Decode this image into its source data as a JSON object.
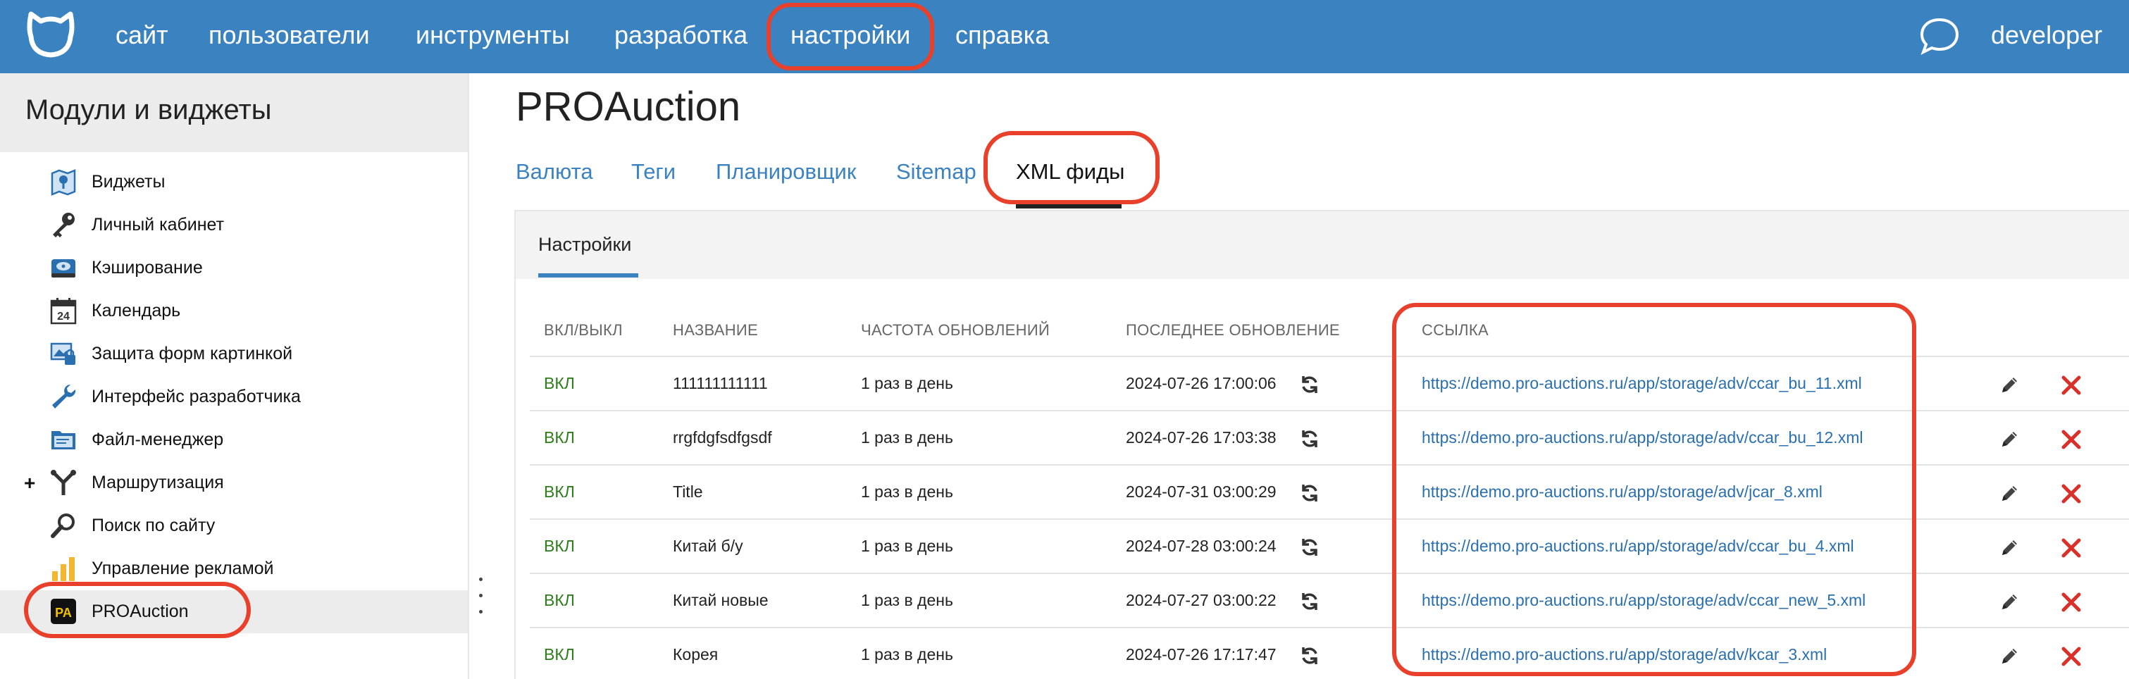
{
  "topbar": {
    "logo_icon": "cat-logo-icon",
    "nav": [
      {
        "label": "сайт"
      },
      {
        "label": "пользователи"
      },
      {
        "label": "инструменты"
      },
      {
        "label": "разработка"
      },
      {
        "label": "настройки"
      },
      {
        "label": "справка"
      }
    ],
    "chat_icon": "chat-bubble-icon",
    "user": "developer"
  },
  "sidebar": {
    "title": "Модули и виджеты",
    "items": [
      {
        "label": "Виджеты",
        "icon": "widgets-map-icon"
      },
      {
        "label": "Личный кабинет",
        "icon": "key-icon"
      },
      {
        "label": "Кэширование",
        "icon": "disk-cache-icon"
      },
      {
        "label": "Календарь",
        "icon": "calendar-icon",
        "icon_text": "24"
      },
      {
        "label": "Защита форм картинкой",
        "icon": "captcha-icon"
      },
      {
        "label": "Интерфейс разработчика",
        "icon": "wrench-icon"
      },
      {
        "label": "Файл-менеджер",
        "icon": "file-manager-icon"
      },
      {
        "label": "Маршрутизация",
        "icon": "routing-icon",
        "expand": "+"
      },
      {
        "label": "Поиск по сайту",
        "icon": "search-icon"
      },
      {
        "label": "Управление рекламой",
        "icon": "ads-chart-icon"
      },
      {
        "label": "PROAuction",
        "icon": "proauction-icon",
        "icon_text": "PA"
      }
    ]
  },
  "main": {
    "title": "PROAuction",
    "tabs": [
      {
        "label": "Валюта"
      },
      {
        "label": "Теги"
      },
      {
        "label": "Планировщик"
      },
      {
        "label": "Sitemap"
      },
      {
        "label": "XML фиды"
      }
    ],
    "subtab": "Настройки",
    "table": {
      "headers": [
        "ВКЛ/ВЫКЛ",
        "НАЗВАНИЕ",
        "ЧАСТОТА ОБНОВЛЕНИЙ",
        "ПОСЛЕДНЕЕ ОБНОВЛЕНИЕ",
        "ССЫЛКА"
      ],
      "rows": [
        {
          "status": "ВКЛ",
          "name": "111111111111",
          "freq": "1 раз в день",
          "updated": "2024-07-26 17:00:06",
          "link": "https://demo.pro-auctions.ru/app/storage/adv/ccar_bu_11.xml"
        },
        {
          "status": "ВКЛ",
          "name": "rrgfdgfsdfgsdf",
          "freq": "1 раз в день",
          "updated": "2024-07-26 17:03:38",
          "link": "https://demo.pro-auctions.ru/app/storage/adv/ccar_bu_12.xml"
        },
        {
          "status": "ВКЛ",
          "name": "Title",
          "freq": "1 раз в день",
          "updated": "2024-07-31 03:00:29",
          "link": "https://demo.pro-auctions.ru/app/storage/adv/jcar_8.xml"
        },
        {
          "status": "ВКЛ",
          "name": "Китай б/у",
          "freq": "1 раз в день",
          "updated": "2024-07-28 03:00:24",
          "link": "https://demo.pro-auctions.ru/app/storage/adv/ccar_bu_4.xml"
        },
        {
          "status": "ВКЛ",
          "name": "Китай новые",
          "freq": "1 раз в день",
          "updated": "2024-07-27 03:00:22",
          "link": "https://demo.pro-auctions.ru/app/storage/adv/ccar_new_5.xml"
        },
        {
          "status": "ВКЛ",
          "name": "Корея",
          "freq": "1 раз в день",
          "updated": "2024-07-26 17:17:47",
          "link": "https://demo.pro-auctions.ru/app/storage/adv/kcar_3.xml"
        }
      ],
      "row_icons": {
        "refresh": "refresh-icon",
        "edit": "pencil-icon",
        "delete": "close-x-icon"
      }
    }
  },
  "colors": {
    "topbar": "#3b83c0",
    "highlight": "#e8402a",
    "on": "#2e7d1b",
    "link": "#2a6fb0"
  }
}
